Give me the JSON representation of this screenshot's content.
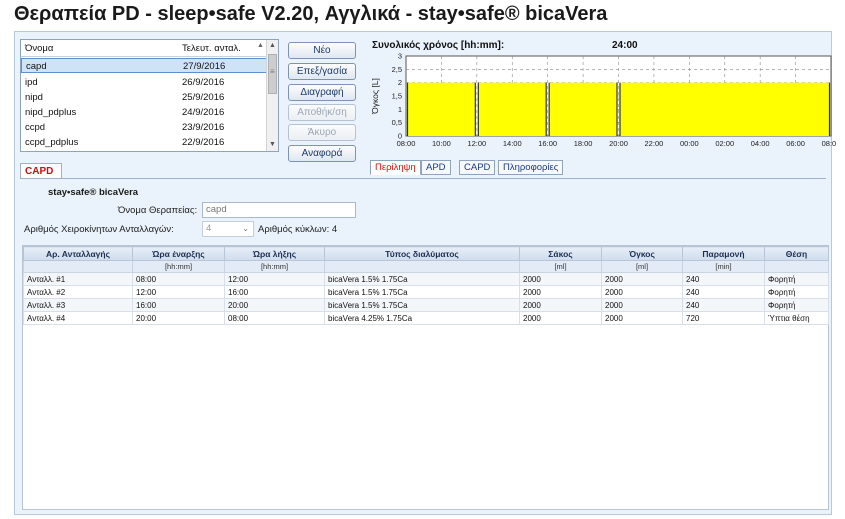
{
  "window": {
    "title": "Θεραπεία PD - sleep•safe V2.20, Αγγλικά - stay•safe® bicaVera"
  },
  "therapy_list": {
    "headers": {
      "name": "Όνομα",
      "last_changed": "Τελευτ. ανταλ."
    },
    "rows": [
      {
        "name": "capd",
        "date": "27/9/2016",
        "selected": true
      },
      {
        "name": "ipd",
        "date": "26/9/2016"
      },
      {
        "name": "nipd",
        "date": "25/9/2016"
      },
      {
        "name": "nipd_pdplus",
        "date": "24/9/2016"
      },
      {
        "name": "ccpd",
        "date": "23/9/2016"
      },
      {
        "name": "ccpd_pdplus",
        "date": "22/9/2016"
      }
    ]
  },
  "buttons": {
    "new": "Νέο",
    "edit": "Επεξ/γασία",
    "delete": "Διαγραφή",
    "save": "Αποθήκ/ση",
    "cancel": "Άκυρο",
    "report": "Αναφορά"
  },
  "chart_header": {
    "label": "Συνολικός χρόνος [hh:mm]:",
    "total": "24:00"
  },
  "chart_tabs": {
    "summary": "Περίληψη",
    "apd": "APD",
    "capd": "CAPD",
    "info": "Πληροφορίες"
  },
  "main_tab": "CAPD",
  "form": {
    "product": "stay•safe® bicaVera",
    "therapy_name_label": "Όνομα Θεραπείας:",
    "therapy_name_value": "capd",
    "manual_exchanges_label": "Αριθμός Χειροκίνητων Ανταλλαγών:",
    "manual_exchanges_value": "4",
    "cycles_label": "Αριθμός κύκλων: 4"
  },
  "table": {
    "headers": [
      "Αρ. Ανταλλαγής",
      "Ώρα έναρξης",
      "Ώρα λήξης",
      "Τύπος διαλύματος",
      "Σάκος",
      "Όγκος",
      "Παραμονή",
      "Θέση"
    ],
    "units": [
      "",
      "[hh:mm]",
      "[hh:mm]",
      "",
      "[ml]",
      "[ml]",
      "[min]",
      ""
    ],
    "rows": [
      [
        "Ανταλλ. #1",
        "08:00",
        "12:00",
        "bicaVera 1.5% 1.75Ca",
        "2000",
        "2000",
        "240",
        "Φορητή"
      ],
      [
        "Ανταλλ. #2",
        "12:00",
        "16:00",
        "bicaVera 1.5% 1.75Ca",
        "2000",
        "2000",
        "240",
        "Φορητή"
      ],
      [
        "Ανταλλ. #3",
        "16:00",
        "20:00",
        "bicaVera 1.5% 1.75Ca",
        "2000",
        "2000",
        "240",
        "Φορητή"
      ],
      [
        "Ανταλλ. #4",
        "20:00",
        "08:00",
        "bicaVera 4.25% 1.75Ca",
        "2000",
        "2000",
        "720",
        "Ύπτια θέση"
      ]
    ]
  },
  "chart_data": {
    "type": "area",
    "ylabel": "Όγκος [L]",
    "xlabel": "",
    "ylim": [
      0,
      3
    ],
    "yticks": [
      "0",
      "0,5",
      "1",
      "1,5",
      "2",
      "2,5",
      "3"
    ],
    "xticks": [
      "08:00",
      "10:00",
      "12:00",
      "14:00",
      "16:00",
      "18:00",
      "20:00",
      "22:00",
      "00:00",
      "02:00",
      "04:00",
      "06:00",
      "08:00"
    ],
    "x_range_hours": [
      0,
      24
    ],
    "series": [
      {
        "segments": [
          {
            "start_h": 0,
            "end_h": 4,
            "volume_l": 2
          },
          {
            "start_h": 4,
            "end_h": 8,
            "volume_l": 2
          },
          {
            "start_h": 8,
            "end_h": 12,
            "volume_l": 2
          },
          {
            "start_h": 12,
            "end_h": 24,
            "volume_l": 2
          }
        ],
        "color": "#ffff00"
      }
    ],
    "grid": true
  },
  "colors": {
    "fill": "#ffff00",
    "accent_red": "#c01414",
    "link_blue": "#1b3a8a"
  }
}
